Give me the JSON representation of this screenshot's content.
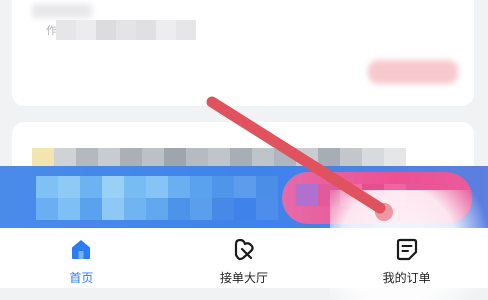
{
  "tabs": [
    {
      "label": "首页",
      "icon": "home-icon",
      "active": true
    },
    {
      "label": "接单大厅",
      "icon": "hall-icon",
      "active": false
    },
    {
      "label": "我的订单",
      "icon": "orders-icon",
      "active": false
    }
  ],
  "card_top": {
    "prefix": "作"
  },
  "colors": {
    "accent": "#2c7cf6",
    "arrow": "#e0525e",
    "band": "#3f83ea",
    "pill": "#ee4f92"
  }
}
